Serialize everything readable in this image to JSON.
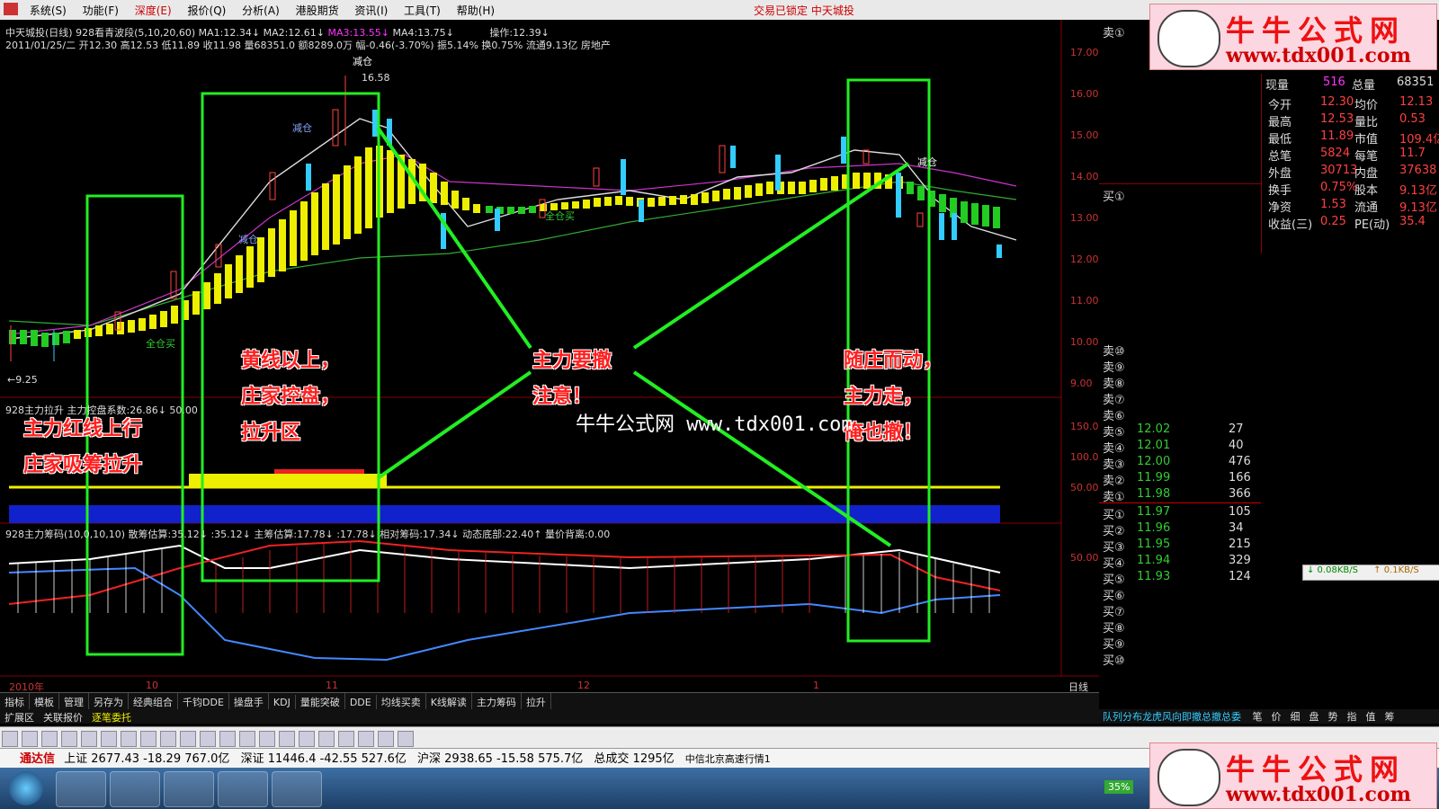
{
  "menu": [
    "系统(S)",
    "功能(F)",
    "深度(E)",
    "报价(Q)",
    "分析(A)",
    "港股期货",
    "资讯(I)",
    "工具(T)",
    "帮助(H)"
  ],
  "title_center": "交易已锁定  中天城投",
  "chart_header": {
    "line1_name": "中天城投(日线) 928看青波段(5,10,20,60)",
    "ma1": "MA1:12.34↓",
    "ma2": "MA2:12.61↓",
    "ma3": "MA3:13.55↓",
    "ma4": "MA4:13.75↓",
    "op": "操作:12.39↓",
    "line2": "2011/01/25/二 开12.30 高12.53 低11.89 收11.98 量68351.0 额8289.0万 幅-0.46(-3.70%) 振5.14% 换0.75% 流通9.13亿 房地产"
  },
  "price_labels": [
    "17.00",
    "16.00",
    "15.00",
    "14.00",
    "13.00",
    "12.00",
    "11.00",
    "10.00",
    "9.00"
  ],
  "high_label": "16.58",
  "low_label": "←9.25",
  "chart_text": {
    "jiancang1": "减仓",
    "jiancang2": "减仓",
    "jiancang3": "减仓",
    "quancang1": "全仓买",
    "quancang2": "全仓买",
    "jiancang4": "减仓"
  },
  "ind1": {
    "title": "928主力拉升  主力控盘系数:26.86↓ 50.00",
    "labels": [
      "150.0",
      "100.0",
      "50.00"
    ]
  },
  "ind2": {
    "title": "928主力筹码(10,0,10,10) 散筹估算:35.12↓ :35.12↓ 主筹估算:17.78↓ :17.78↓ 相对筹码:17.34↓ 动态底部:22.40↑ 量价背离:0.00",
    "label": "50.00"
  },
  "x_labels": {
    "y2010": "2010年",
    "m10": "10",
    "m11": "11",
    "m12": "12",
    "m1": "1",
    "period": "日线"
  },
  "annotations": {
    "a1": [
      "主力红线上行",
      "庄家吸筹拉升"
    ],
    "a2": [
      "黄线以上，",
      "庄家控盘，",
      "拉升区"
    ],
    "a3": [
      "主力要撤",
      "注意！"
    ],
    "a4": [
      "随庄而动，",
      "主力走，",
      "俺也撤！"
    ]
  },
  "watermark": "牛牛公式网 www.tdx001.com",
  "quote": {
    "sell1_label": "卖①",
    "buy1_label": "买①",
    "xianliang": "现量",
    "xianliang_v": "516",
    "zongliang": "总量",
    "zongliang_v": "68351",
    "rows": [
      {
        "k1": "今开",
        "v1": "12.30",
        "k2": "均价",
        "v2": "12.13"
      },
      {
        "k1": "最高",
        "v1": "12.53",
        "k2": "量比",
        "v2": "0.53"
      },
      {
        "k1": "最低",
        "v1": "11.89",
        "k2": "市值",
        "v2": "109.4亿"
      },
      {
        "k1": "总笔",
        "v1": "5824",
        "k2": "每笔",
        "v2": "11.7"
      },
      {
        "k1": "外盘",
        "v1": "30713",
        "k2": "内盘",
        "v2": "37638"
      },
      {
        "k1": "换手",
        "v1": "0.75%",
        "k2": "股本",
        "v2": "9.13亿"
      },
      {
        "k1": "净资",
        "v1": "1.53",
        "k2": "流通",
        "v2": "9.13亿"
      },
      {
        "k1": "收益(三)",
        "v1": "0.25",
        "k2": "PE(动)",
        "v2": "35.4"
      }
    ],
    "sells": [
      {
        "l": "卖⑩",
        "p": "",
        "v": ""
      },
      {
        "l": "卖⑨",
        "p": "",
        "v": ""
      },
      {
        "l": "卖⑧",
        "p": "",
        "v": ""
      },
      {
        "l": "卖⑦",
        "p": "",
        "v": ""
      },
      {
        "l": "卖⑥",
        "p": "",
        "v": ""
      },
      {
        "l": "卖⑤",
        "p": "12.02",
        "v": "27"
      },
      {
        "l": "卖④",
        "p": "12.01",
        "v": "40"
      },
      {
        "l": "卖③",
        "p": "12.00",
        "v": "476"
      },
      {
        "l": "卖②",
        "p": "11.99",
        "v": "166"
      },
      {
        "l": "卖①",
        "p": "11.98",
        "v": "366"
      }
    ],
    "buys": [
      {
        "l": "买①",
        "p": "11.97",
        "v": "105"
      },
      {
        "l": "买②",
        "p": "11.96",
        "v": "34"
      },
      {
        "l": "买③",
        "p": "11.95",
        "v": "215"
      },
      {
        "l": "买④",
        "p": "11.94",
        "v": "329"
      },
      {
        "l": "买⑤",
        "p": "11.93",
        "v": "124"
      },
      {
        "l": "买⑥",
        "p": "",
        "v": ""
      },
      {
        "l": "买⑦",
        "p": "",
        "v": ""
      },
      {
        "l": "买⑧",
        "p": "",
        "v": ""
      },
      {
        "l": "买⑨",
        "p": "",
        "v": ""
      },
      {
        "l": "买⑩",
        "p": "",
        "v": ""
      }
    ]
  },
  "speed": {
    "down": "↓ 0.08KB/S",
    "up": "↑ 0.1KB/S"
  },
  "tabs": [
    "指标",
    "模板",
    "管理",
    "另存为",
    "经典组合",
    "千钧DDE",
    "操盘手",
    "KDJ",
    "量能突破",
    "DDE",
    "均线买卖",
    "K线解读",
    "主力筹码",
    "拉升"
  ],
  "tabs2": [
    "扩展区",
    "关联报价",
    "逐笔委托"
  ],
  "right_tabs": "队列分布龙虎风向即撤总撤总委",
  "right_tabs2": [
    "笔",
    "价",
    "细",
    "盘",
    "势",
    "指",
    "值",
    "筹"
  ],
  "status": {
    "brand": "通达信",
    "sh": "上证 2677.43  -18.29  767.0亿",
    "sz": "深证 11446.4  -42.55  527.6亿",
    "hs": "沪深 2938.65  -15.58  575.7亿",
    "total": "总成交  1295亿",
    "server": "中信北京高速行情1"
  },
  "ad": {
    "t1": "牛牛公式网",
    "t2": "www.tdx001.com"
  },
  "battery": "35%"
}
